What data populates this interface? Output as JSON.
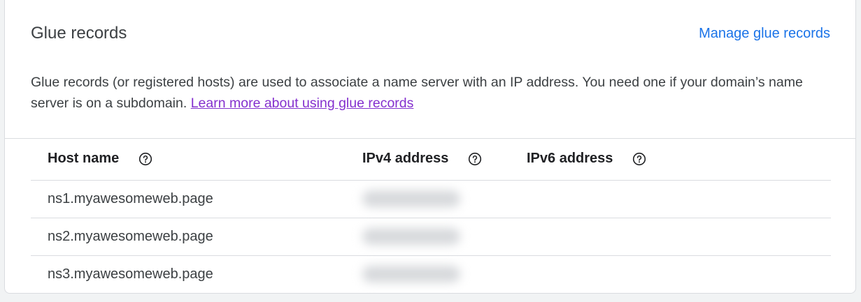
{
  "card": {
    "title": "Glue records",
    "manage_link": "Manage glue records",
    "description": "Glue records (or registered hosts) are used to associate a name server with an IP address. You need one if your domain’s name server is on a subdomain.",
    "learn_more": "Learn more about using glue records"
  },
  "table": {
    "headers": {
      "host": "Host name",
      "ipv4": "IPv4 address",
      "ipv6": "IPv6 address"
    },
    "rows": [
      {
        "host": "ns1.myawesomeweb.page",
        "ipv4": "",
        "ipv6": ""
      },
      {
        "host": "ns2.myawesomeweb.page",
        "ipv4": "",
        "ipv6": ""
      },
      {
        "host": "ns3.myawesomeweb.page",
        "ipv4": "",
        "ipv6": ""
      }
    ]
  },
  "colors": {
    "link": "#1a73e8",
    "visited_link": "#8430ce",
    "text": "#3c4043",
    "divider": "#dadce0"
  },
  "icons": {
    "help": "help-circle-icon"
  }
}
